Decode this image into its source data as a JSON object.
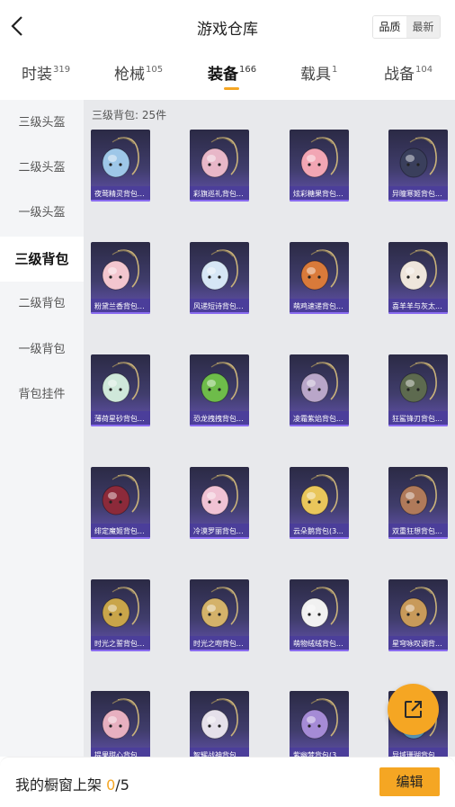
{
  "header": {
    "title": "游戏仓库",
    "back_icon": "chevron-left-icon",
    "sort": {
      "quality_label": "品质",
      "latest_label": "最新",
      "selected": "品质"
    }
  },
  "tabs": [
    {
      "label": "时装",
      "count": "319"
    },
    {
      "label": "枪械",
      "count": "105"
    },
    {
      "label": "装备",
      "count": "166",
      "active": true
    },
    {
      "label": "载具",
      "count": "1"
    },
    {
      "label": "战备",
      "count": "104"
    }
  ],
  "sidebar": {
    "items": [
      {
        "label": "三级头盔"
      },
      {
        "label": "二级头盔"
      },
      {
        "label": "一级头盔"
      },
      {
        "label": "三级背包",
        "active": true
      },
      {
        "label": "二级背包"
      },
      {
        "label": "一级背包"
      },
      {
        "label": "背包挂件"
      }
    ]
  },
  "section": {
    "title": "三级背包: 25件"
  },
  "items": [
    {
      "name": "夜莺精灵背包...",
      "art": "#9ec7e8"
    },
    {
      "name": "彩旗巡礼背包...",
      "art": "#e8b7c8"
    },
    {
      "name": "炫彩糖果背包...",
      "art": "#f2a6b4"
    },
    {
      "name": "异瞳寒姬背包...",
      "art": "#3a3f5c"
    },
    {
      "name": "粉黛兰香背包...",
      "art": "#f3c6cf"
    },
    {
      "name": "风递短诗背包...",
      "art": "#d6e6f5"
    },
    {
      "name": "萌鸡速递背包...",
      "art": "#d97a3a"
    },
    {
      "name": "喜羊羊与灰太...",
      "art": "#efe6dc"
    },
    {
      "name": "薄荷星砂背包...",
      "art": "#cfe8da"
    },
    {
      "name": "恐龙拽拽背包...",
      "art": "#6ebc4a"
    },
    {
      "name": "凌霜紫焰背包...",
      "art": "#b9a6c9"
    },
    {
      "name": "狂鲨锋刃背包...",
      "art": "#5d6a4f"
    },
    {
      "name": "绯定魔姬背包...",
      "art": "#8c2a3a"
    },
    {
      "name": "冷漠罗丽背包...",
      "art": "#f0c2d4"
    },
    {
      "name": "云朵鹅背包(3...",
      "art": "#e9c65b"
    },
    {
      "name": "双重狂想背包...",
      "art": "#b07a5a"
    },
    {
      "name": "时光之誓背包...",
      "art": "#c9a54a"
    },
    {
      "name": "时光之吻背包...",
      "art": "#d4b26a"
    },
    {
      "name": "萌物绒绒背包...",
      "art": "#f1f1f1"
    },
    {
      "name": "星穹咏叹调背...",
      "art": "#c89a5a"
    },
    {
      "name": "提果甜心背包...",
      "art": "#e7b0c0"
    },
    {
      "name": "智耀战神背包...",
      "art": "#e5e0ea"
    },
    {
      "name": "紫幽梦背包(3...",
      "art": "#a58bd6"
    },
    {
      "name": "异域珊瑚背包...",
      "art": "#5fa3c8"
    }
  ],
  "footer": {
    "label": "我的橱窗上架",
    "count_current": "0",
    "count_total": "/5",
    "edit_label": "编辑"
  },
  "fab": {
    "icon": "share-external-icon"
  },
  "colors": {
    "accent": "#f5a623",
    "card_name_bg": "#4b3e9a"
  }
}
